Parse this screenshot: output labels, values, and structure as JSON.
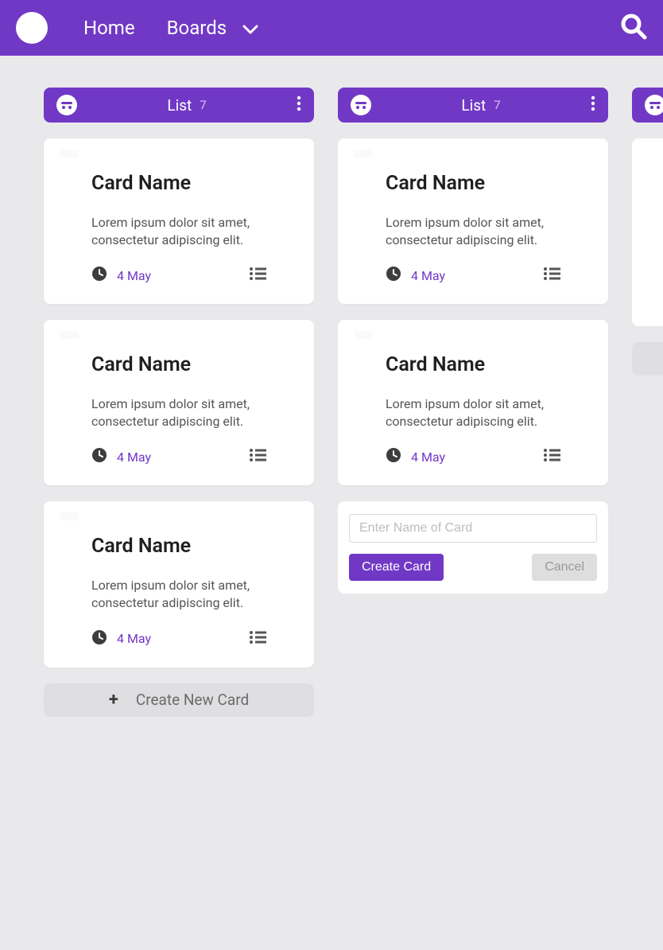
{
  "colors": {
    "accent": "#7138c6"
  },
  "header": {
    "home_label": "Home",
    "boards_label": "Boards"
  },
  "lists": [
    {
      "title": "List",
      "count": "7",
      "cards": [
        {
          "title": "Card Name",
          "desc": "Lorem ipsum dolor sit amet, consectetur adipiscing elit.",
          "date": "4 May"
        },
        {
          "title": "Card Name",
          "desc": "Lorem ipsum dolor sit amet, consectetur adipiscing elit.",
          "date": "4 May"
        },
        {
          "title": "Card Name",
          "desc": "Lorem ipsum dolor sit amet, consectetur adipiscing elit.",
          "date": "4 May"
        }
      ],
      "create_label": "Create New Card"
    },
    {
      "title": "List",
      "count": "7",
      "cards": [
        {
          "title": "Card Name",
          "desc": "Lorem ipsum dolor sit amet, consectetur adipiscing elit.",
          "date": "4 May"
        },
        {
          "title": "Card Name",
          "desc": "Lorem ipsum dolor sit amet, consectetur adipiscing elit.",
          "date": "4 May"
        }
      ],
      "create_form": {
        "placeholder": "Enter Name of Card",
        "submit_label": "Create Card",
        "cancel_label": "Cancel"
      }
    },
    {
      "title": "",
      "count": "",
      "partial": true
    }
  ]
}
